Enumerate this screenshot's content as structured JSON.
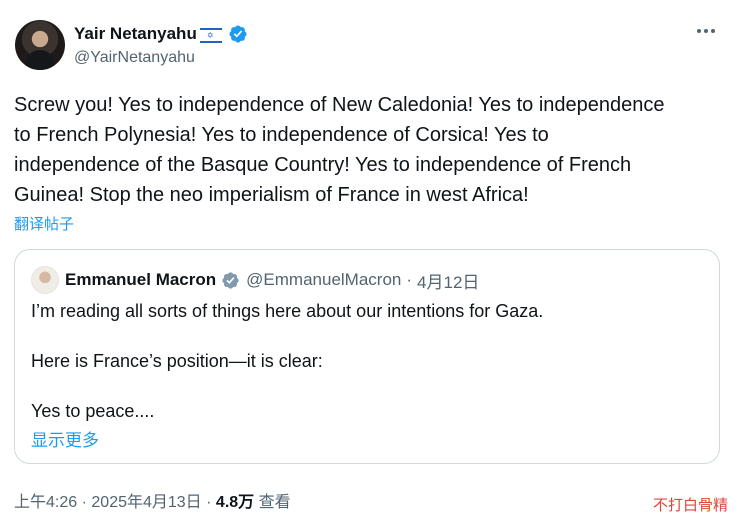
{
  "tweet": {
    "author_name": "Yair Netanyahu",
    "author_flag": "✡",
    "author_handle": "@YairNetanyahu",
    "text": "Screw you! Yes to independence of New Caledonia! Yes to independence\nto French Polynesia! Yes to independence of Corsica! Yes to\nindependence of the Basque Country! Yes to independence of French\nGuinea! Stop the neo imperialism of France in west Africa!",
    "translate_label": "翻译帖子",
    "time": "上午4:26",
    "date": "2025年4月13日",
    "views_count": "4.8万",
    "views_label": "查看",
    "separator": "·"
  },
  "quote": {
    "author_name": "Emmanuel Macron",
    "author_handle": "@EmmanuelMacron",
    "separator": "·",
    "date": "4月12日",
    "line1": "I’m reading all sorts of things here about our intentions for Gaza.",
    "line2": "Here is France’s position—it is clear:",
    "line3": "Yes to peace....",
    "show_more": "显示更多"
  },
  "watermark": "不打白骨精",
  "colors": {
    "accent": "#1d9bf0",
    "muted": "#536471",
    "text": "#0f1419",
    "border": "#cfd9de",
    "watermark": "#e0453a"
  },
  "icons": [
    "verified-badge-icon",
    "more-options-icon",
    "israel-flag-icon"
  ]
}
